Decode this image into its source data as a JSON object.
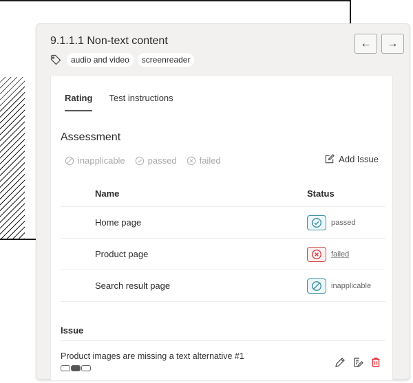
{
  "criterion": {
    "title": "9.1.1.1 Non-text content",
    "tags": [
      "audio and video",
      "screenreader"
    ]
  },
  "nav": {
    "prev_label": "←",
    "next_label": "→"
  },
  "tabs": [
    {
      "label": "Rating",
      "active": true
    },
    {
      "label": "Test instructions",
      "active": false
    }
  ],
  "assessment": {
    "title": "Assessment",
    "options": [
      {
        "label": "inapplicable",
        "icon": "slash-circle-icon"
      },
      {
        "label": "passed",
        "icon": "check-circle-icon"
      },
      {
        "label": "failed",
        "icon": "x-circle-icon"
      }
    ],
    "add_issue_label": "Add Issue"
  },
  "table": {
    "headers": {
      "name": "Name",
      "status": "Status"
    },
    "rows": [
      {
        "name": "Home page",
        "status": "passed"
      },
      {
        "name": "Product page",
        "status": "failed"
      },
      {
        "name": "Search result page",
        "status": "inapplicable"
      }
    ]
  },
  "issues": {
    "title": "Issue",
    "items": [
      {
        "text": "Product images are missing a text alternative #1",
        "severity_level": 2,
        "severity_max": 3
      }
    ]
  },
  "colors": {
    "passed": "#3b8fa8",
    "failed": "#cf4646",
    "inapplicable": "#3b8fa8",
    "delete": "#e0343a"
  }
}
